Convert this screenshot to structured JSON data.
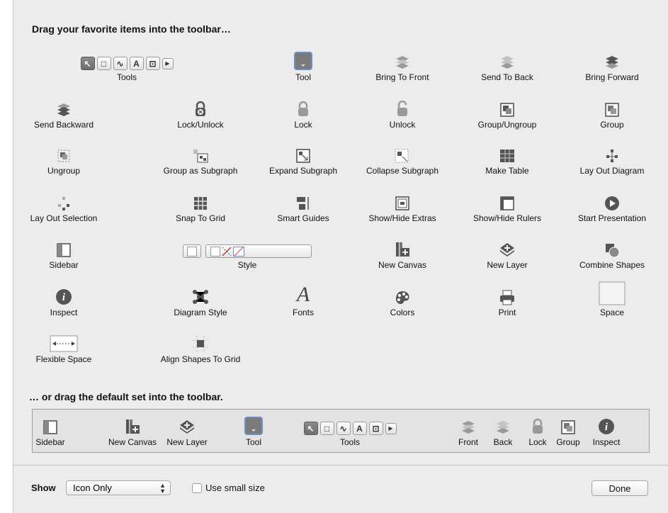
{
  "header": {
    "title": "Drag your favorite items into the toolbar…"
  },
  "items": [
    {
      "label": "Tools",
      "icon": "tools-segmented-icon"
    },
    {
      "label": "Tool",
      "icon": "tool-icon"
    },
    {
      "label": "Bring To Front",
      "icon": "bring-to-front-icon"
    },
    {
      "label": "Send To Back",
      "icon": "send-to-back-icon"
    },
    {
      "label": "Bring Forward",
      "icon": "bring-forward-icon"
    },
    {
      "label": "Send Backward",
      "icon": "send-backward-icon"
    },
    {
      "label": "Lock/Unlock",
      "icon": "lock-unlock-icon"
    },
    {
      "label": "Lock",
      "icon": "lock-icon"
    },
    {
      "label": "Unlock",
      "icon": "unlock-icon"
    },
    {
      "label": "Group/Ungroup",
      "icon": "group-ungroup-icon"
    },
    {
      "label": "Group",
      "icon": "group-icon"
    },
    {
      "label": "Ungroup",
      "icon": "ungroup-icon"
    },
    {
      "label": "Group as Subgraph",
      "icon": "group-as-subgraph-icon"
    },
    {
      "label": "Expand Subgraph",
      "icon": "expand-subgraph-icon"
    },
    {
      "label": "Collapse Subgraph",
      "icon": "collapse-subgraph-icon"
    },
    {
      "label": "Make Table",
      "icon": "make-table-icon"
    },
    {
      "label": "Lay Out Diagram",
      "icon": "lay-out-diagram-icon"
    },
    {
      "label": "Lay Out Selection",
      "icon": "lay-out-selection-icon"
    },
    {
      "label": "Snap To Grid",
      "icon": "snap-to-grid-icon"
    },
    {
      "label": "Smart Guides",
      "icon": "smart-guides-icon"
    },
    {
      "label": "Show/Hide Extras",
      "icon": "show-hide-extras-icon"
    },
    {
      "label": "Show/Hide Rulers",
      "icon": "show-hide-rulers-icon"
    },
    {
      "label": "Start Presentation",
      "icon": "start-presentation-icon"
    },
    {
      "label": "Sidebar",
      "icon": "sidebar-icon"
    },
    {
      "label": "Style",
      "icon": "style-wells-icon"
    },
    {
      "label": "New Canvas",
      "icon": "new-canvas-icon"
    },
    {
      "label": "New Layer",
      "icon": "new-layer-icon"
    },
    {
      "label": "Combine Shapes",
      "icon": "combine-shapes-icon"
    },
    {
      "label": "Inspect",
      "icon": "inspect-icon"
    },
    {
      "label": "Diagram Style",
      "icon": "diagram-style-icon"
    },
    {
      "label": "Fonts",
      "icon": "fonts-icon"
    },
    {
      "label": "Colors",
      "icon": "colors-icon"
    },
    {
      "label": "Print",
      "icon": "print-icon"
    },
    {
      "label": "Space",
      "icon": "space-icon"
    },
    {
      "label": "Flexible Space",
      "icon": "flexible-space-icon"
    },
    {
      "label": "Align Shapes To Grid",
      "icon": "align-shapes-to-grid-icon"
    }
  ],
  "default_set": {
    "header": "… or drag the default set into the toolbar.",
    "items": [
      {
        "label": "Sidebar",
        "icon": "sidebar-icon"
      },
      {
        "label": "New Canvas",
        "icon": "new-canvas-icon"
      },
      {
        "label": "New Layer",
        "icon": "new-layer-icon"
      },
      {
        "label": "Tool",
        "icon": "tool-icon"
      },
      {
        "label": "Tools",
        "icon": "tools-segmented-icon"
      },
      {
        "label": "Front",
        "icon": "bring-to-front-icon"
      },
      {
        "label": "Back",
        "icon": "send-to-back-icon"
      },
      {
        "label": "Lock",
        "icon": "lock-icon"
      },
      {
        "label": "Group",
        "icon": "group-icon"
      },
      {
        "label": "Inspect",
        "icon": "inspect-icon"
      }
    ]
  },
  "footer": {
    "show_label": "Show",
    "show_value": "Icon Only",
    "small_size_label": "Use small size",
    "small_size_checked": false,
    "done_label": "Done"
  },
  "colors": {
    "sheet_bg": "#ececec",
    "icon_dark": "#4a4a4a",
    "tool_blue": "#6d8fc7"
  }
}
